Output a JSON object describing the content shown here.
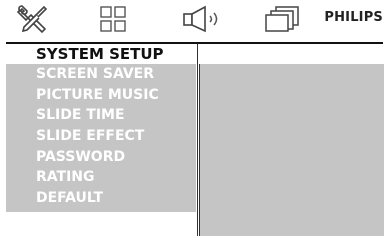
{
  "topbar": {
    "icons": [
      {
        "name": "tools-icon"
      },
      {
        "name": "grid-icon"
      },
      {
        "name": "audio-speaker-icon"
      },
      {
        "name": "picture-frames-icon"
      }
    ],
    "brand": "PHILIPS"
  },
  "page": {
    "title": "SYSTEM SETUP"
  },
  "menu": {
    "items": [
      {
        "label": "SCREEN SAVER"
      },
      {
        "label": "PICTURE MUSIC"
      },
      {
        "label": "SLIDE TIME"
      },
      {
        "label": "SLIDE EFFECT"
      },
      {
        "label": "PASSWORD"
      },
      {
        "label": "RATING"
      },
      {
        "label": "DEFAULT"
      }
    ]
  },
  "colors": {
    "panel_bg": "#c5c5c5",
    "menu_text": "#ffffff",
    "title_text": "#111111"
  }
}
